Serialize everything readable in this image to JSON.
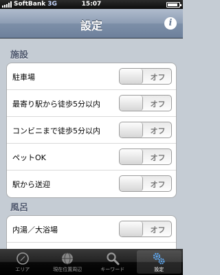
{
  "status": {
    "carrier": "SoftBank",
    "network": "3G",
    "time": "15:07",
    "battery_level": 0.8
  },
  "navbar": {
    "title": "設定",
    "info_icon_label": "i"
  },
  "sections": [
    {
      "header": "施設",
      "rows": [
        {
          "label": "駐車場",
          "toggle": "オフ"
        },
        {
          "label": "最寄り駅から徒歩5分以内",
          "toggle": "オフ"
        },
        {
          "label": "コンビニまで徒歩5分以内",
          "toggle": "オフ"
        },
        {
          "label": "ペットOK",
          "toggle": "オフ"
        },
        {
          "label": "駅から送迎",
          "toggle": "オフ"
        }
      ]
    },
    {
      "header": "風呂",
      "rows": [
        {
          "label": "内湯／大浴場",
          "toggle": "オフ"
        }
      ]
    }
  ],
  "tabbar": {
    "tabs": [
      {
        "label": "エリア",
        "icon": "compass-icon"
      },
      {
        "label": "現在位置周辺",
        "icon": "globe-icon"
      },
      {
        "label": "キーワード",
        "icon": "search-icon"
      },
      {
        "label": "設定",
        "icon": "gears-icon"
      }
    ],
    "active_index": 3
  }
}
